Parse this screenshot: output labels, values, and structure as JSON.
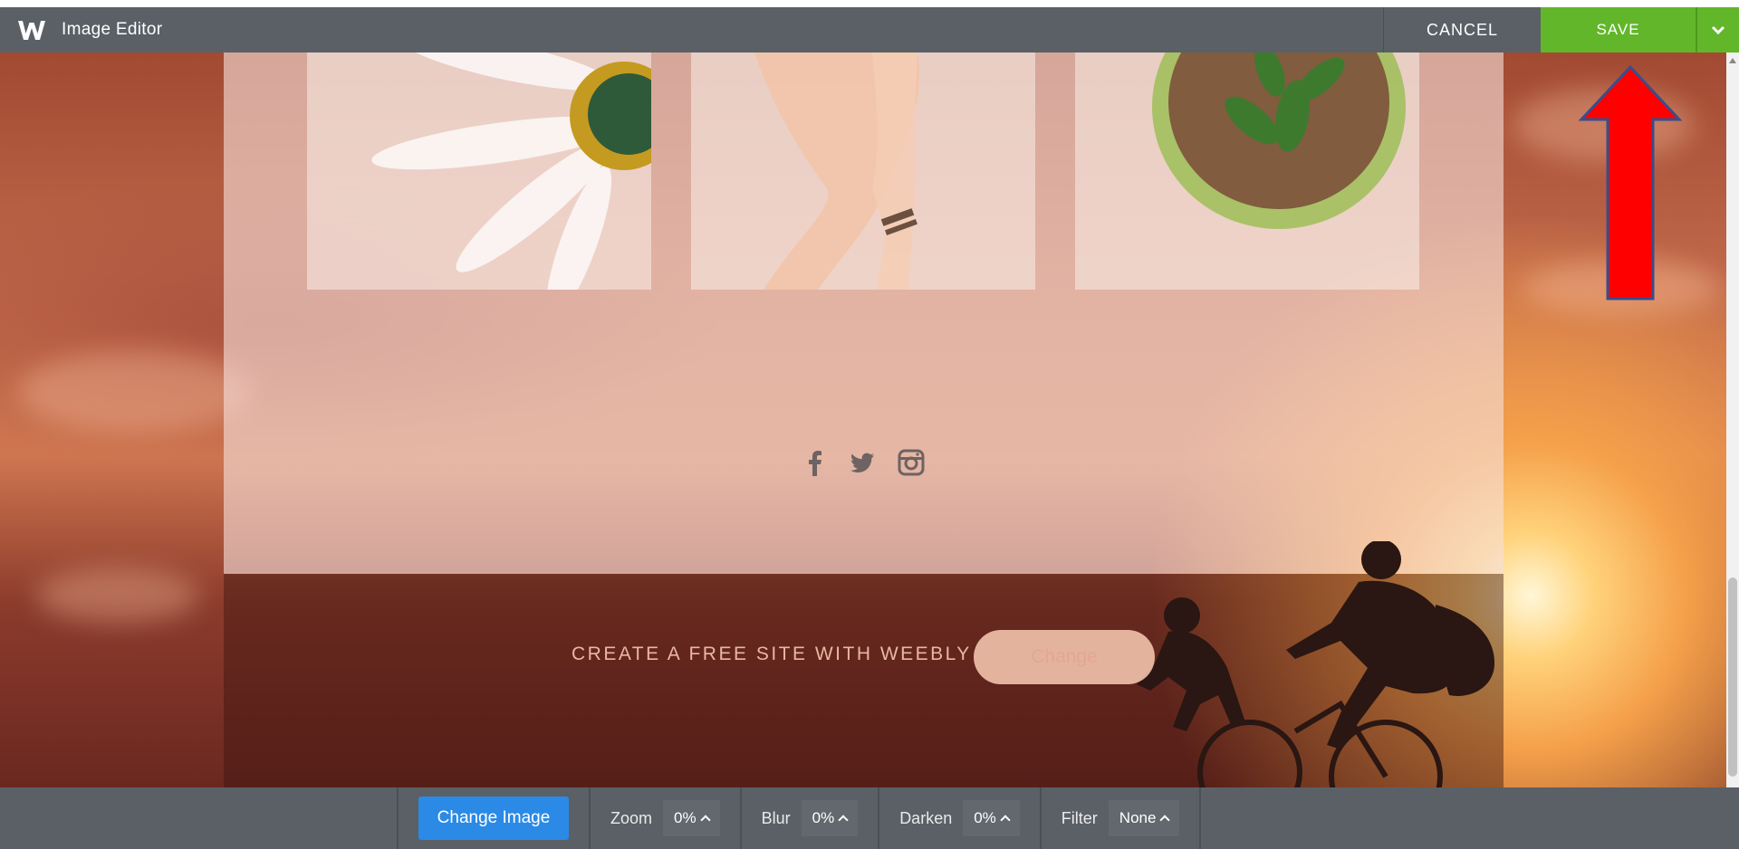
{
  "header": {
    "app_title": "Image Editor",
    "cancel_label": "CANCEL",
    "save_label": "SAVE"
  },
  "content": {
    "cta_text": "CREATE A FREE SITE WITH WEEBLY",
    "cta_button_label": "Change"
  },
  "toolbar": {
    "change_image_label": "Change Image",
    "zoom_label": "Zoom",
    "zoom_value": "0%",
    "blur_label": "Blur",
    "blur_value": "0%",
    "darken_label": "Darken",
    "darken_value": "0%",
    "filter_label": "Filter",
    "filter_value": "None"
  },
  "icons": [
    "weebly-logo-icon",
    "chevron-down-icon",
    "facebook-icon",
    "twitter-icon",
    "instagram-icon",
    "chevron-up-icon"
  ],
  "colors": {
    "save": "#62b62a",
    "change_image": "#2a8ae6",
    "topbar": "#5a6066",
    "annotation_arrow": "#ff0000"
  }
}
